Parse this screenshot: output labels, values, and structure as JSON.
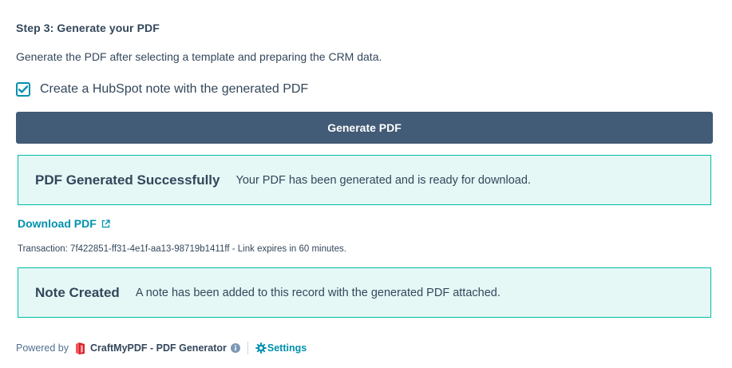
{
  "step": {
    "title": "Step 3: Generate your PDF",
    "description": "Generate the PDF after selecting a template and preparing the CRM data."
  },
  "note_option": {
    "label": "Create a HubSpot note with the generated PDF",
    "checked": true
  },
  "generate_button": {
    "label": "Generate PDF",
    "color": "#425b76"
  },
  "success_alert": {
    "title": "PDF Generated Successfully",
    "message": "Your PDF has been generated and is ready for download."
  },
  "download": {
    "label": "Download PDF",
    "icon": "external-link-icon"
  },
  "transaction_text": "Transaction: 7f422851-ff31-4e1f-aa13-98719b1411ff - Link expires in 60 minutes.",
  "note_alert": {
    "title": "Note Created",
    "message": "A note has been added to this record with the generated PDF attached."
  },
  "footer": {
    "powered_by": "Powered by",
    "app_name": "CraftMyPDF - PDF Generator",
    "settings_label": "Settings",
    "icons": [
      "craftmypdf-logo-icon",
      "info-icon",
      "gear-icon"
    ]
  },
  "colors": {
    "text": "#33475b",
    "accent": "#0091ae",
    "alert_bg": "#e5f8f6",
    "alert_border": "#00bda5",
    "logo": "#e8383d"
  }
}
